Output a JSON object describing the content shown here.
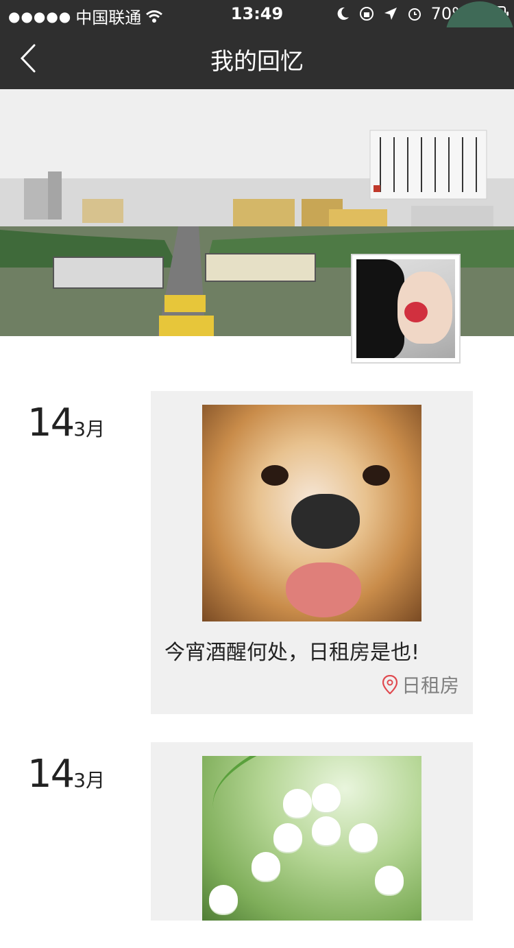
{
  "status_bar": {
    "carrier": "中国联通",
    "signal_dots": "●●●●●",
    "time": "13:49",
    "battery_percent": "70%",
    "battery_color": "#F4C400"
  },
  "nav": {
    "title": "我的回忆",
    "back_icon": "chevron-left-icon"
  },
  "banner": {
    "image_desc": "campus-watercolor-banner",
    "avatar_desc": "girl-with-rose-avatar"
  },
  "timeline": {
    "entries": [
      {
        "day": "14",
        "month": "3月",
        "photo": "dog-photo",
        "caption": "今宵酒醒何处，日租房是也!",
        "location": "日租房",
        "location_icon": "map-pin-icon"
      },
      {
        "day": "14",
        "month": "3月",
        "photo": "lily-of-the-valley-photo"
      }
    ]
  },
  "colors": {
    "nav_bg": "#2F2F2F",
    "card_bg": "#F0F0F0",
    "pin_red": "#E0494F",
    "floating_circle": "#3F6A57"
  }
}
